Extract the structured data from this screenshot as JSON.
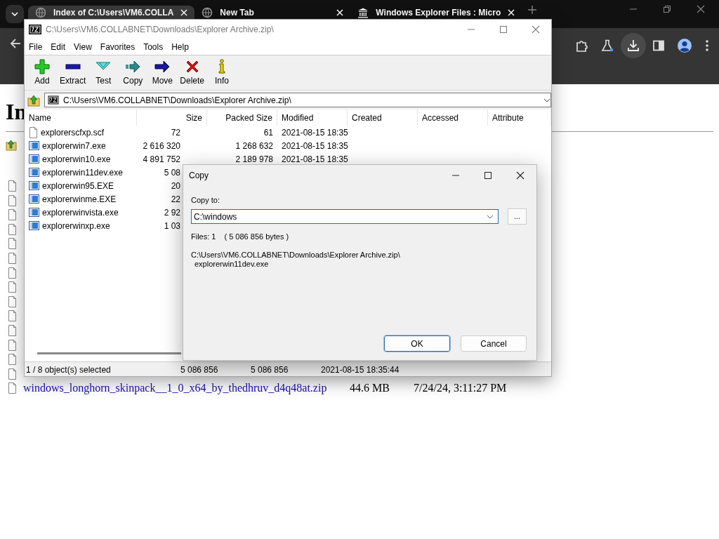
{
  "browser": {
    "tabs": [
      {
        "title": "Index of C:\\Users\\VM6.COLLA",
        "selected": true
      },
      {
        "title": "New Tab",
        "selected": false
      },
      {
        "title": "Windows Explorer Files : Micro",
        "selected": false
      }
    ],
    "page": {
      "heading": "In",
      "listing": [
        {
          "name": "windows_longhorn_skinpack__1_0_x64_by_thedhruv_d4q48at.zip",
          "size": "44.6 MB",
          "date": "7/24/24, 3:11:27 PM"
        }
      ]
    }
  },
  "archive_window": {
    "title": "C:\\Users\\VM6.COLLABNET\\Downloads\\Explorer Archive.zip\\",
    "menu": [
      "File",
      "Edit",
      "View",
      "Favorites",
      "Tools",
      "Help"
    ],
    "toolbar": [
      {
        "label": "Add",
        "kind": "add"
      },
      {
        "label": "Extract",
        "kind": "extract"
      },
      {
        "label": "Test",
        "kind": "test"
      },
      {
        "label": "Copy",
        "kind": "copy"
      },
      {
        "label": "Move",
        "kind": "move"
      },
      {
        "label": "Delete",
        "kind": "delete"
      },
      {
        "label": "Info",
        "kind": "info"
      }
    ],
    "address": "C:\\Users\\VM6.COLLABNET\\Downloads\\Explorer Archive.zip\\",
    "columns": [
      "Name",
      "Size",
      "Packed Size",
      "Modified",
      "Created",
      "Accessed",
      "Attribute"
    ],
    "rows": [
      {
        "name": "explorerscfxp.scf",
        "kind": "file",
        "size": "72",
        "packed_size": "61",
        "modified": "2021-08-15 18:35"
      },
      {
        "name": "explorerwin7.exe",
        "kind": "exe",
        "size": "2 616 320",
        "packed_size": "1 268 632",
        "modified": "2021-08-15 18:35"
      },
      {
        "name": "explorerwin10.exe",
        "kind": "exe",
        "size": "4 891 752",
        "packed_size": "2 189 978",
        "modified": "2021-08-15 18:35"
      },
      {
        "name": "explorerwin11dev.exe",
        "kind": "exe",
        "size": "5 08"
      },
      {
        "name": "explorerwin95.EXE",
        "kind": "exe",
        "size": "20"
      },
      {
        "name": "explorerwinme.EXE",
        "kind": "exe",
        "size": "22"
      },
      {
        "name": "explorerwinvista.exe",
        "kind": "exe",
        "size": "2 92"
      },
      {
        "name": "explorerwinxp.exe",
        "kind": "exe",
        "size": "1 03"
      }
    ],
    "status_bar": [
      "1 / 8 object(s) selected",
      "5 086 856",
      "5 086 856",
      "2021-08-15 18:35:44"
    ]
  },
  "copy_dialog": {
    "title": "Copy",
    "label": "Copy to:",
    "value": "C:\\windows",
    "browse": "...",
    "files": "Files: 1",
    "bytes": "( 5 086 856 bytes )",
    "path_lines": [
      "C:\\Users\\VM6.COLLABNET\\Downloads\\Explorer Archive.zip\\",
      "explorerwin11dev.exe"
    ],
    "buttons": [
      {
        "label": "OK",
        "default": true
      },
      {
        "label": "Cancel",
        "default": false
      }
    ]
  }
}
